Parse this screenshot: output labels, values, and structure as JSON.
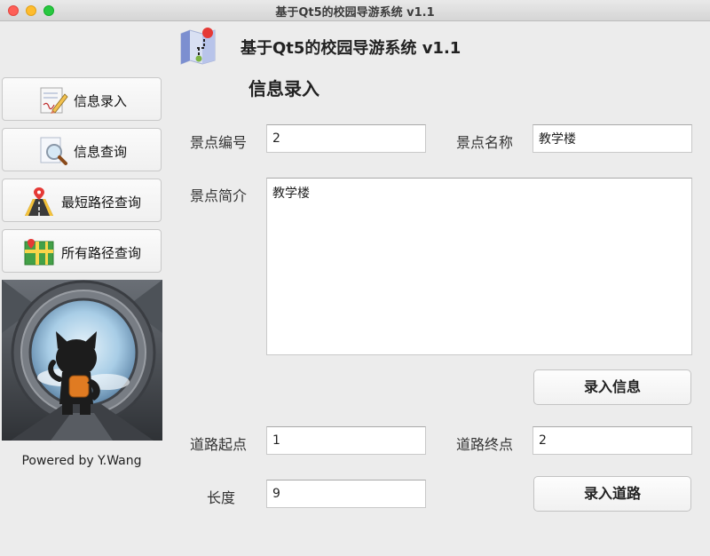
{
  "window": {
    "title": "基于Qt5的校园导游系统 v1.1"
  },
  "header": {
    "app_title": "基于Qt5的校园导游系统 v1.1",
    "logo_icon": "map-pin-logo-icon"
  },
  "page": {
    "section_title": "信息录入"
  },
  "sidebar": {
    "items": [
      {
        "label": "信息录入",
        "icon": "pencil-paper-icon"
      },
      {
        "label": "信息查询",
        "icon": "magnifier-icon"
      },
      {
        "label": "最短路径查询",
        "icon": "road-pin-icon"
      },
      {
        "label": "所有路径查询",
        "icon": "map-icon"
      }
    ],
    "powered_by": "Powered by Y.Wang"
  },
  "form": {
    "spot_id": {
      "label": "景点编号",
      "value": "2"
    },
    "spot_name": {
      "label": "景点名称",
      "value": "教学楼"
    },
    "spot_desc": {
      "label": "景点简介",
      "value": "教学楼"
    },
    "submit_info_label": "录入信息",
    "road_start": {
      "label": "道路起点",
      "value": "1"
    },
    "road_end": {
      "label": "道路终点",
      "value": "2"
    },
    "length": {
      "label": "长度",
      "value": "9"
    },
    "submit_road_label": "录入道路"
  },
  "colors": {
    "close": "#fe5f57",
    "minimize": "#febc2e",
    "maximize": "#28c840"
  }
}
